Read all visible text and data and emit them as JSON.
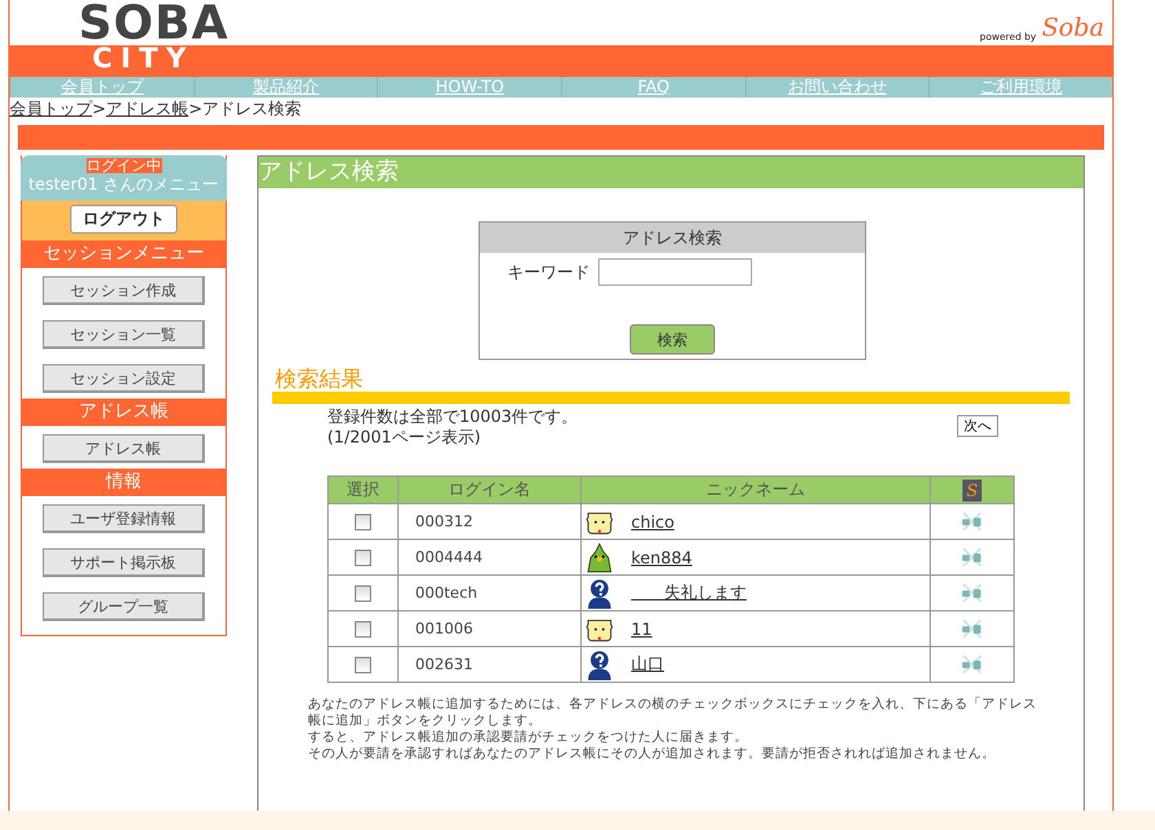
{
  "header": {
    "logo_top": "SOBA",
    "logo_bottom": "CITY",
    "powered_by": "powered by",
    "brand": "Soba"
  },
  "nav": [
    {
      "label": "会員トップ"
    },
    {
      "label": "製品紹介"
    },
    {
      "label": "HOW-TO"
    },
    {
      "label": "FAQ"
    },
    {
      "label": "お問い合わせ"
    },
    {
      "label": "ご利用環境"
    }
  ],
  "breadcrumb": [
    {
      "label": "会員トップ",
      "link": true
    },
    {
      "label": ">",
      "link": false
    },
    {
      "label": "アドレス帳",
      "link": true
    },
    {
      "label": ">アドレス検索",
      "link": false
    }
  ],
  "sidebar": {
    "status_badge": "ログイン中",
    "menu_title": "tester01 さんのメニュー",
    "logout": "ログアウト",
    "sections": [
      {
        "title": "セッションメニュー",
        "items": [
          "セッション作成",
          "セッション一覧",
          "セッション設定"
        ]
      },
      {
        "title": "アドレス帳",
        "items": [
          "アドレス帳"
        ]
      },
      {
        "title": "情報",
        "items": [
          "ユーザ登録情報",
          "サポート掲示板",
          "グループ一覧"
        ]
      }
    ]
  },
  "main": {
    "title": "アドレス検索",
    "search_box": {
      "title": "アドレス検索",
      "keyword_label": "キーワード",
      "button": "検索"
    },
    "results_title": "検索結果",
    "summary": "登録件数は全部で10003件です。",
    "page_info": "(1/2001ページ表示)",
    "next_button": "次へ",
    "table": {
      "columns": [
        "選択",
        "ログイン名",
        "ニックネーム",
        "S"
      ],
      "rows": [
        {
          "checked": false,
          "login": "000312",
          "kind": "dog",
          "nickname": "chico"
        },
        {
          "checked": false,
          "login": "0004444",
          "kind": "bird",
          "nickname": "ken884"
        },
        {
          "checked": false,
          "login": "000tech",
          "kind": "unknown",
          "nickname": "　　失礼します"
        },
        {
          "checked": false,
          "login": "001006",
          "kind": "dog",
          "nickname": "11"
        },
        {
          "checked": false,
          "login": "002631",
          "kind": "unknown",
          "nickname": "山口"
        }
      ]
    },
    "notes": [
      "あなたのアドレス帳に追加するためには、各アドレスの横のチェックボックスにチェックを入れ、下にある「アドレス帳に追加」ボタンをクリックします。",
      "すると、アドレス帳追加の承認要請がチェックをつけた人に届きます。",
      "その人が要請を承認すればあなたのアドレス帳にその人が追加されます。要請が拒否されれば追加されません。"
    ]
  }
}
